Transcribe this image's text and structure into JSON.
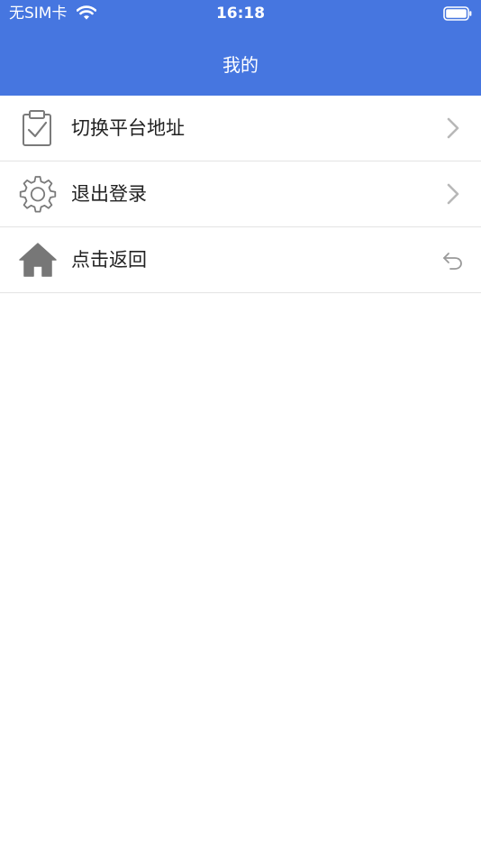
{
  "status_bar": {
    "carrier": "无SIM卡",
    "time": "16:18"
  },
  "nav": {
    "title": "我的"
  },
  "menu": {
    "items": [
      {
        "label": "切换平台地址",
        "icon": "clipboard-check-icon",
        "accessory": "chevron-right-icon"
      },
      {
        "label": "退出登录",
        "icon": "gear-icon",
        "accessory": "chevron-right-icon"
      },
      {
        "label": "点击返回",
        "icon": "home-icon",
        "accessory": "return-arrow-icon"
      }
    ]
  },
  "colors": {
    "header_bg": "#4676e0",
    "text": "#222222",
    "divider": "#e3e3e3",
    "icon_gray": "#777777",
    "accessory_gray": "#b8b8b8"
  }
}
